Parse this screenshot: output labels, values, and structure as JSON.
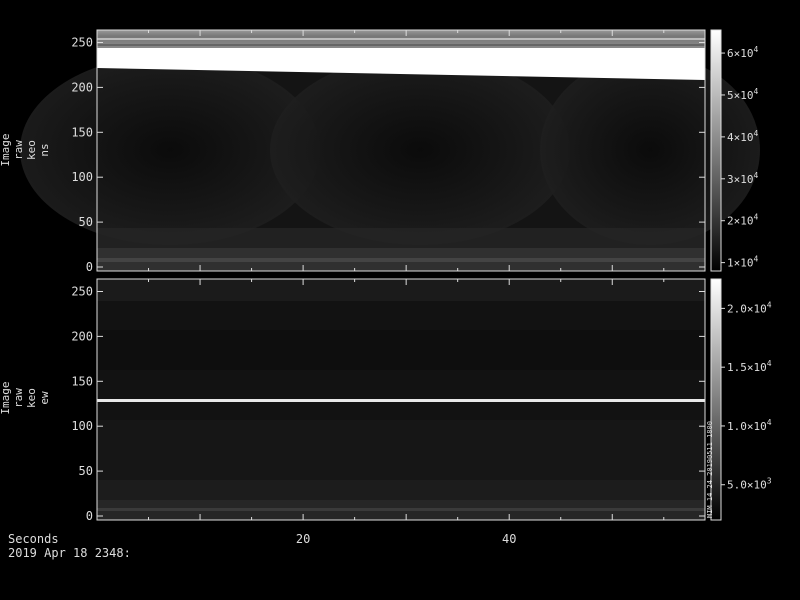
{
  "chart_data": [
    {
      "type": "heatmap",
      "panel": "top",
      "ylabel_lines": [
        "Image",
        "raw",
        "keo",
        "ns"
      ],
      "ylim": [
        0,
        255
      ],
      "yticks": [
        "0",
        "50",
        "100",
        "150",
        "200",
        "250"
      ],
      "xlim": [
        0,
        59
      ],
      "colorbar": {
        "range": [
          8000,
          65500
        ],
        "ticks": [
          {
            "mantissa": "1",
            "exp": "4",
            "value": 10000
          },
          {
            "mantissa": "2",
            "exp": "4",
            "value": 20000
          },
          {
            "mantissa": "3",
            "exp": "4",
            "value": 30000
          },
          {
            "mantissa": "4",
            "exp": "4",
            "value": 40000
          },
          {
            "mantissa": "5",
            "exp": "4",
            "value": 50000
          },
          {
            "mantissa": "6",
            "exp": "4",
            "value": 60000
          }
        ]
      },
      "features": {
        "saturated_band": {
          "y_top": 245,
          "y_bottom_start": 215,
          "y_bottom_end": 202,
          "level": 65000
        },
        "background_level": 9000
      }
    },
    {
      "type": "heatmap",
      "panel": "bottom",
      "ylabel_lines": [
        "Image",
        "raw",
        "keo",
        "ew"
      ],
      "ylim": [
        0,
        255
      ],
      "yticks": [
        "0",
        "50",
        "100",
        "150",
        "200",
        "250"
      ],
      "xlim": [
        0,
        59
      ],
      "colorbar": {
        "range": [
          2000,
          22500
        ],
        "ticks": [
          {
            "mantissa": "5.0",
            "exp": "3",
            "value": 5000
          },
          {
            "mantissa": "1.0",
            "exp": "4",
            "value": 10000
          },
          {
            "mantissa": "1.5",
            "exp": "4",
            "value": 15000
          },
          {
            "mantissa": "2.0",
            "exp": "4",
            "value": 20000
          }
        ],
        "side_text": "MIM 14 24 20190511 1800"
      },
      "features": {
        "bright_line": {
          "y": 127,
          "level": 22000
        },
        "background_level": 3500
      }
    }
  ],
  "x_axis": {
    "label": "Seconds",
    "ticks": [
      "20",
      "40"
    ],
    "tick_values": [
      20,
      40
    ]
  },
  "footer": {
    "date_line": "2019 Apr 18 2348:"
  }
}
